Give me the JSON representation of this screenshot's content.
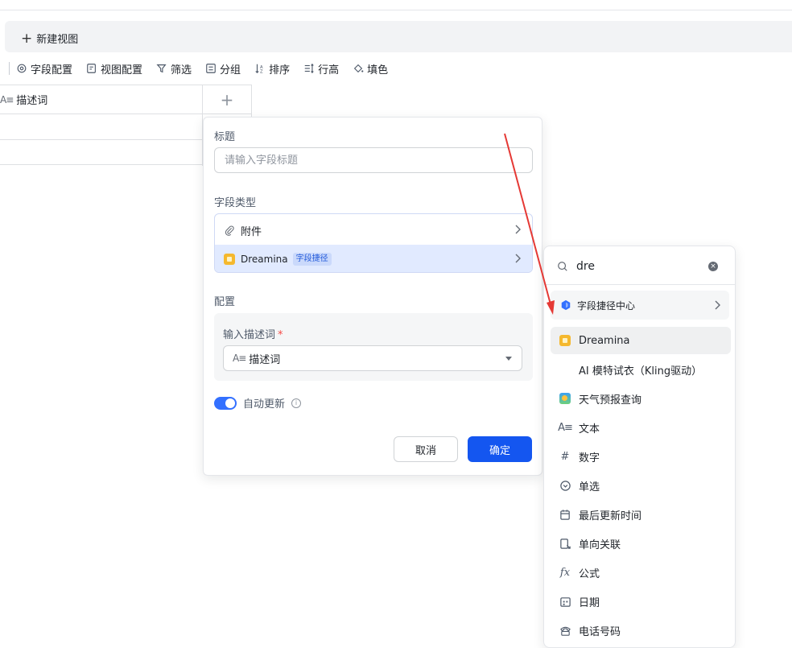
{
  "viewbar": {
    "new_view": "新建视图"
  },
  "toolbar": {
    "items": [
      "字段配置",
      "视图配置",
      "筛选",
      "分组",
      "排序",
      "行高",
      "填色"
    ]
  },
  "grid": {
    "column_label": "描述词",
    "add_column": "+"
  },
  "panel": {
    "title_label": "标题",
    "title_placeholder": "请输入字段标题",
    "type_label": "字段类型",
    "type_rows": [
      {
        "label": "附件"
      },
      {
        "label": "Dreamina",
        "badge": "字段捷径"
      }
    ],
    "config_label": "配置",
    "config_field_label": "输入描述词",
    "config_required_mark": "*",
    "config_select_value": "描述词",
    "auto_update_label": "自动更新",
    "info_glyph": "i",
    "cancel": "取消",
    "confirm": "确定"
  },
  "dropdown": {
    "search_value": "dre",
    "center_label": "字段捷径中心",
    "items": [
      {
        "label": "Dreamina",
        "icon": "dreamina-icon",
        "highlighted": true
      },
      {
        "label": "AI 模特试衣（Kling驱动）",
        "icon": "none"
      },
      {
        "label": "天气预报查询",
        "icon": "weather-icon"
      },
      {
        "label": "文本",
        "icon": "text-icon"
      },
      {
        "label": "数字",
        "icon": "hash-icon"
      },
      {
        "label": "单选",
        "icon": "single-select-icon"
      },
      {
        "label": "最后更新时间",
        "icon": "calendar-edit-icon"
      },
      {
        "label": "单向关联",
        "icon": "link-icon"
      },
      {
        "label": "公式",
        "icon": "formula-icon"
      },
      {
        "label": "日期",
        "icon": "date-icon"
      },
      {
        "label": "电话号码",
        "icon": "phone-icon"
      }
    ]
  },
  "colors": {
    "primary": "#1456f0",
    "selected_bg": "#e1eaff",
    "arrow": "#e53935"
  }
}
